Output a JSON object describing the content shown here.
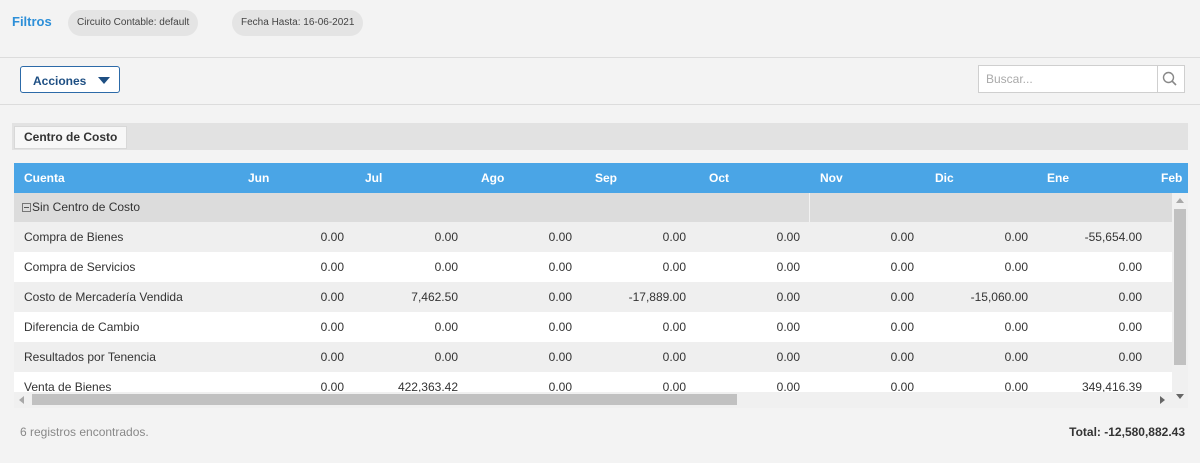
{
  "filters": {
    "title": "Filtros",
    "chips": [
      "Circuito Contable: default",
      "Fecha Hasta: 16-06-2021"
    ]
  },
  "toolbar": {
    "actions_label": "Acciones",
    "search_placeholder": "Buscar..."
  },
  "grouping": {
    "label": "Centro de Costo"
  },
  "grid": {
    "columns": [
      "Cuenta",
      "Jun",
      "Jul",
      "Ago",
      "Sep",
      "Oct",
      "Nov",
      "Dic",
      "Ene",
      "Feb"
    ],
    "group_label": "Sin Centro de Costo",
    "rows": [
      {
        "cuenta": "Compra de Bienes",
        "values": [
          "0.00",
          "0.00",
          "0.00",
          "0.00",
          "0.00",
          "0.00",
          "0.00",
          "-55,654.00"
        ]
      },
      {
        "cuenta": "Compra de Servicios",
        "values": [
          "0.00",
          "0.00",
          "0.00",
          "0.00",
          "0.00",
          "0.00",
          "0.00",
          "0.00"
        ]
      },
      {
        "cuenta": "Costo de Mercadería Vendida",
        "values": [
          "0.00",
          "7,462.50",
          "0.00",
          "-17,889.00",
          "0.00",
          "0.00",
          "-15,060.00",
          "0.00"
        ]
      },
      {
        "cuenta": "Diferencia de Cambio",
        "values": [
          "0.00",
          "0.00",
          "0.00",
          "0.00",
          "0.00",
          "0.00",
          "0.00",
          "0.00"
        ]
      },
      {
        "cuenta": "Resultados por Tenencia",
        "values": [
          "0.00",
          "0.00",
          "0.00",
          "0.00",
          "0.00",
          "0.00",
          "0.00",
          "0.00"
        ]
      },
      {
        "cuenta": "Venta de Bienes",
        "values": [
          "0.00",
          "422,363.42",
          "0.00",
          "0.00",
          "0.00",
          "0.00",
          "0.00",
          "349,416.39"
        ]
      }
    ]
  },
  "footer": {
    "count_text": "6 registros encontrados.",
    "total_text": "Total: -12,580,882.43"
  }
}
